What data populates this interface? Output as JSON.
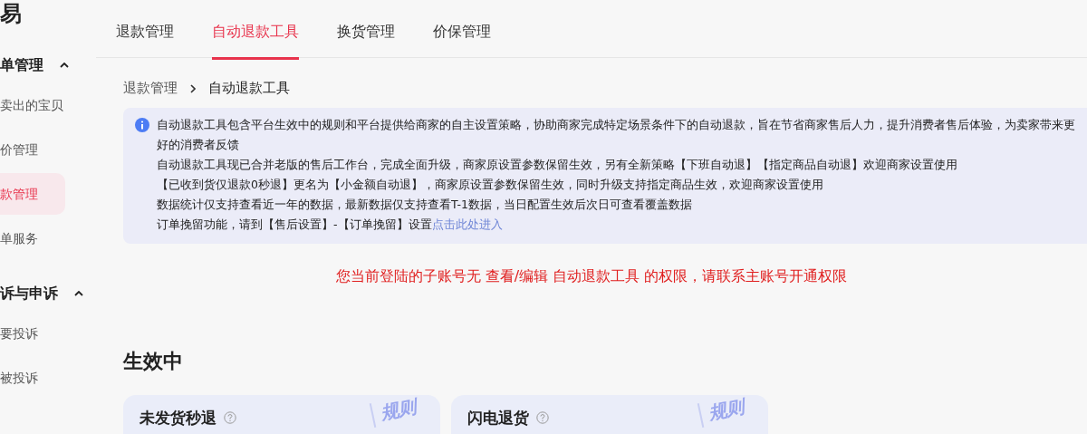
{
  "sidebar": {
    "logo": "易",
    "groups": [
      {
        "title": "单管理",
        "expanded": true,
        "items": [
          {
            "label": "卖出的宝贝",
            "selected": false
          },
          {
            "label": "价管理",
            "selected": false
          },
          {
            "label": "款管理",
            "selected": true
          },
          {
            "label": "单服务",
            "selected": false
          }
        ]
      },
      {
        "title": "诉与申诉",
        "expanded": true,
        "items": [
          {
            "label": "要投诉",
            "selected": false
          },
          {
            "label": "被投诉",
            "selected": false
          }
        ]
      }
    ]
  },
  "tabs": [
    {
      "label": "退款管理",
      "selected": false
    },
    {
      "label": "自动退款工具",
      "selected": true
    },
    {
      "label": "换货管理",
      "selected": false
    },
    {
      "label": "价保管理",
      "selected": false
    }
  ],
  "breadcrumb": [
    "退款管理",
    "自动退款工具"
  ],
  "notice": {
    "lines": [
      "自动退款工具包含平台生效中的规则和平台提供给商家的自主设置策略，协助商家完成特定场景条件下的自动退款，旨在节省商家售后人力，提升消费者售后体验，为卖家带来更好的消费者反馈",
      "自动退款工具现已合并老版的售后工作台，完成全面升级，商家原设置参数保留生效，另有全新策略【下班自动退】【指定商品自动退】欢迎商家设置使用",
      "【已收到货仅退款0秒退】更名为【小金额自动退】，商家原设置参数保留生效，同时升级支持指定商品生效，欢迎商家设置使用",
      "数据统计仅支持查看近一年的数据，最新数据仅支持查看T-1数据，当日配置生效后次日可查看覆盖数据",
      "订单挽留功能，请到【售后设置】-【订单挽留】设置"
    ],
    "link": "点击此处进入"
  },
  "permission_warning": "您当前登陆的子账号无 查看/编辑 自动退款工具 的权限，请联系主账号开通权限",
  "section_title": "生效中",
  "cards": [
    {
      "title": "未发货秒退",
      "stamp": "规则"
    },
    {
      "title": "闪电退货",
      "stamp": "规则"
    }
  ]
}
